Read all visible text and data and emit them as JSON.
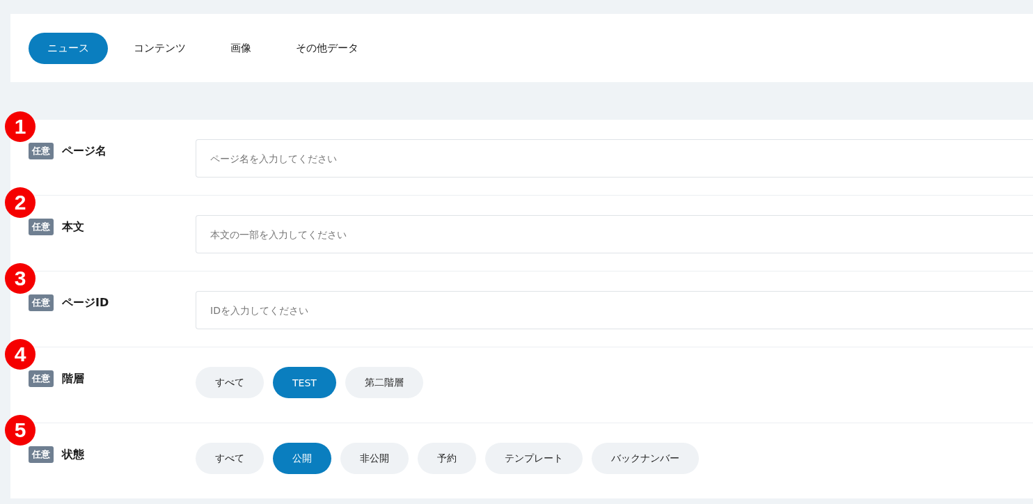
{
  "tabs": [
    {
      "label": "ニュース",
      "selected": true
    },
    {
      "label": "コンテンツ",
      "selected": false
    },
    {
      "label": "画像",
      "selected": false
    },
    {
      "label": "その他データ",
      "selected": false
    }
  ],
  "fields": [
    {
      "number": "1",
      "badge": "任意",
      "label": "ページ名",
      "kind": "text",
      "placeholder": "ページ名を入力してください"
    },
    {
      "number": "2",
      "badge": "任意",
      "label": "本文",
      "kind": "text",
      "placeholder": "本文の一部を入力してください"
    },
    {
      "number": "3",
      "badge": "任意",
      "label": "ページID",
      "kind": "text",
      "placeholder": "IDを入力してください"
    },
    {
      "number": "4",
      "badge": "任意",
      "label": "階層",
      "kind": "chips",
      "options": [
        {
          "label": "すべて",
          "selected": false
        },
        {
          "label": "TEST",
          "selected": true
        },
        {
          "label": "第二階層",
          "selected": false
        }
      ]
    },
    {
      "number": "5",
      "badge": "任意",
      "label": "状態",
      "kind": "chips",
      "options": [
        {
          "label": "すべて",
          "selected": false
        },
        {
          "label": "公開",
          "selected": true
        },
        {
          "label": "非公開",
          "selected": false
        },
        {
          "label": "予約",
          "selected": false
        },
        {
          "label": "テンプレート",
          "selected": false
        },
        {
          "label": "バックナンバー",
          "selected": false
        }
      ]
    }
  ]
}
